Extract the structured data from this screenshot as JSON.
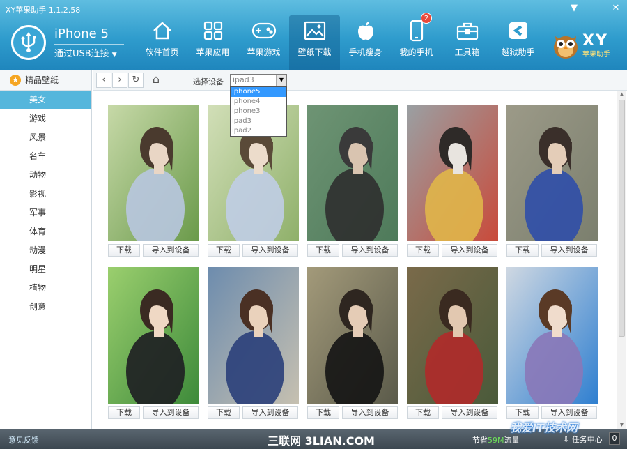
{
  "window": {
    "title": "XY苹果助手 1.1.2.58",
    "controls": [
      "▼",
      "–",
      "✕"
    ]
  },
  "device": {
    "name": "iPhone 5",
    "connection": "通过USB连接",
    "caret": "▼"
  },
  "nav": [
    {
      "label": "软件首页",
      "icon": "home-icon"
    },
    {
      "label": "苹果应用",
      "icon": "apps-grid-icon"
    },
    {
      "label": "苹果游戏",
      "icon": "gamepad-icon"
    },
    {
      "label": "壁纸下载",
      "icon": "picture-icon",
      "active": true
    },
    {
      "label": "手机瘦身",
      "icon": "apple-icon"
    },
    {
      "label": "我的手机",
      "icon": "phone-icon",
      "badge": "2"
    },
    {
      "label": "工具箱",
      "icon": "toolbox-icon"
    },
    {
      "label": "越狱助手",
      "icon": "jailbreak-icon"
    }
  ],
  "brand": {
    "logo": "XY",
    "name": "苹果助手"
  },
  "sidebar": {
    "header": "精品壁纸",
    "items": [
      "美女",
      "游戏",
      "风景",
      "名车",
      "动物",
      "影视",
      "军事",
      "体育",
      "动漫",
      "明星",
      "植物",
      "创意"
    ],
    "active_index": 0
  },
  "toolbar": {
    "back": "‹",
    "forward": "›",
    "refresh": "↻",
    "home": "⌂",
    "device_label": "选择设备",
    "selected_device": "ipad3",
    "options": [
      "iphone5",
      "iphone4",
      "iphone3",
      "ipad3",
      "ipad2"
    ],
    "highlighted_option": 0
  },
  "wallpapers": {
    "download_label": "下载",
    "import_label": "导入到设备",
    "items": [
      {
        "palette": [
          "#6a9a4a",
          "#c7d9a8",
          "#4a3a2e",
          "#e9d6c5",
          "#b8c7e0"
        ]
      },
      {
        "palette": [
          "#8fb06a",
          "#d2dfb8",
          "#5a4a38",
          "#ecdccb",
          "#c0cde6"
        ]
      },
      {
        "palette": [
          "#4e7a5a",
          "#6e9474",
          "#3a3a3a",
          "#d9c4b0",
          "#2f2f2f"
        ]
      },
      {
        "palette": [
          "#c94a3a",
          "#9aa0a3",
          "#2e2a28",
          "#e8e4df",
          "#e0b64a"
        ]
      },
      {
        "palette": [
          "#7b7f6e",
          "#9c9a88",
          "#3a2f2a",
          "#e4cdb8",
          "#2f4ea8"
        ]
      },
      {
        "palette": [
          "#3d8a3a",
          "#9bcf6e",
          "#3a2a22",
          "#efd8c4",
          "#1e1e22"
        ]
      },
      {
        "palette": [
          "#c6c0b0",
          "#6d8cae",
          "#4a3024",
          "#ead2bc",
          "#2a3f7a"
        ]
      },
      {
        "palette": [
          "#5a5a4a",
          "#a39a7a",
          "#2e2620",
          "#e5ccb6",
          "#141414"
        ]
      },
      {
        "palette": [
          "#4a5a3a",
          "#7a6a4a",
          "#3a2a20",
          "#e2c8b0",
          "#b02a2a"
        ]
      },
      {
        "palette": [
          "#2f7fd0",
          "#cfd8e2",
          "#5a3a26",
          "#f0dccc",
          "#8a78b8"
        ]
      }
    ]
  },
  "statusbar": {
    "feedback": "意见反馈",
    "watermark": "三联网 3LIAN.COM",
    "saved_prefix": "节省",
    "saved_value": "59M",
    "saved_suffix": "流量",
    "tasks": "任务中心",
    "task_count": "0",
    "corner_watermark": "我爱IT技术网"
  },
  "colors": {
    "header": "#2f9ccd",
    "sidebar_active": "#55b6dc",
    "badge": "#e84a3a",
    "statusbar": "#46525b"
  }
}
